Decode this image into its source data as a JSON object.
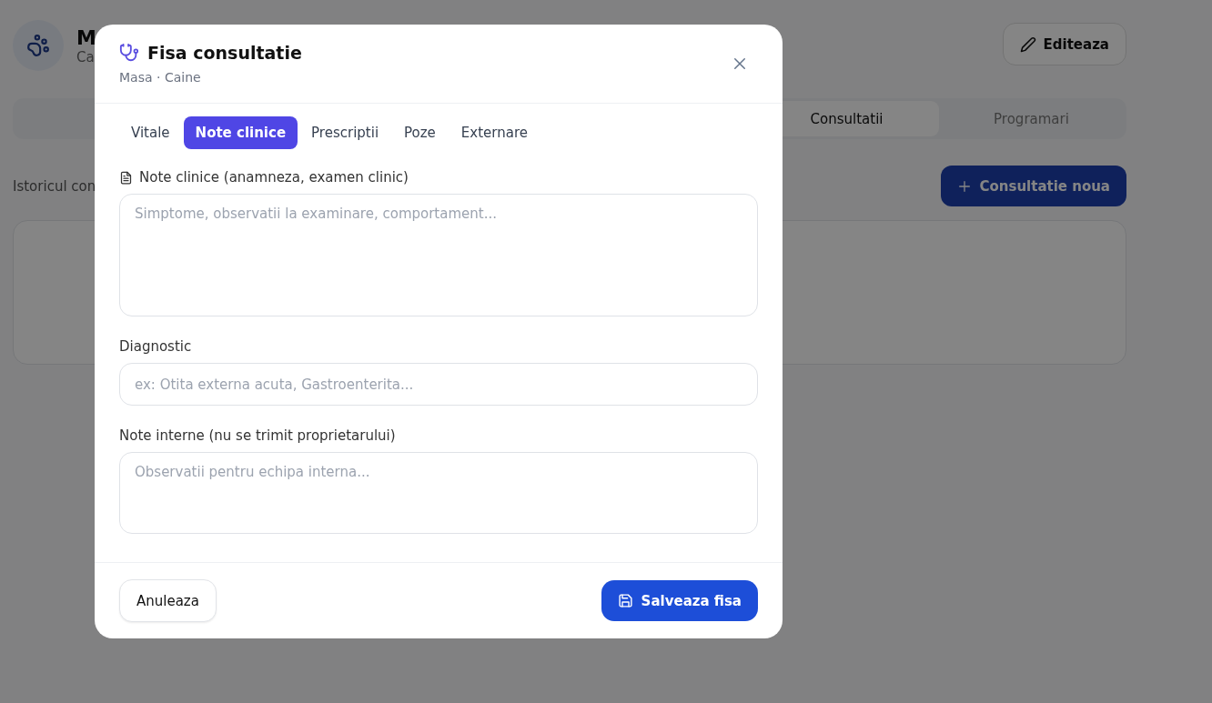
{
  "page": {
    "pet_name": "M",
    "pet_subtitle": "Ca",
    "edit_button": "Editeaza",
    "tabs": [
      {
        "label": "Consultatii",
        "selected": true
      },
      {
        "label": "Programari",
        "selected": false
      }
    ],
    "history_label": "Istoricul con",
    "new_button": "Consultatie noua"
  },
  "dialog": {
    "title": "Fisa consultatie",
    "subtitle": "Masa · Caine",
    "tabs": [
      {
        "label": "Vitale",
        "selected": false
      },
      {
        "label": "Note clinice",
        "selected": true
      },
      {
        "label": "Prescriptii",
        "selected": false
      },
      {
        "label": "Poze",
        "selected": false
      },
      {
        "label": "Externare",
        "selected": false
      }
    ],
    "fields": [
      {
        "kind": "notes",
        "label": "Note clinice (anamneza, examen clinic)",
        "icon": true,
        "placeholder": "Simptome, observatii la examinare, comportament..."
      },
      {
        "kind": "input",
        "label": "Diagnostic",
        "icon": false,
        "placeholder": "ex: Otita externa acuta, Gastroenterita..."
      },
      {
        "kind": "memo",
        "label": "Note interne (nu se trimit proprietarului)",
        "icon": false,
        "placeholder": "Observatii pentru echipa interna..."
      }
    ],
    "cancel_button": "Anuleaza",
    "save_button": "Salveaza fisa"
  }
}
